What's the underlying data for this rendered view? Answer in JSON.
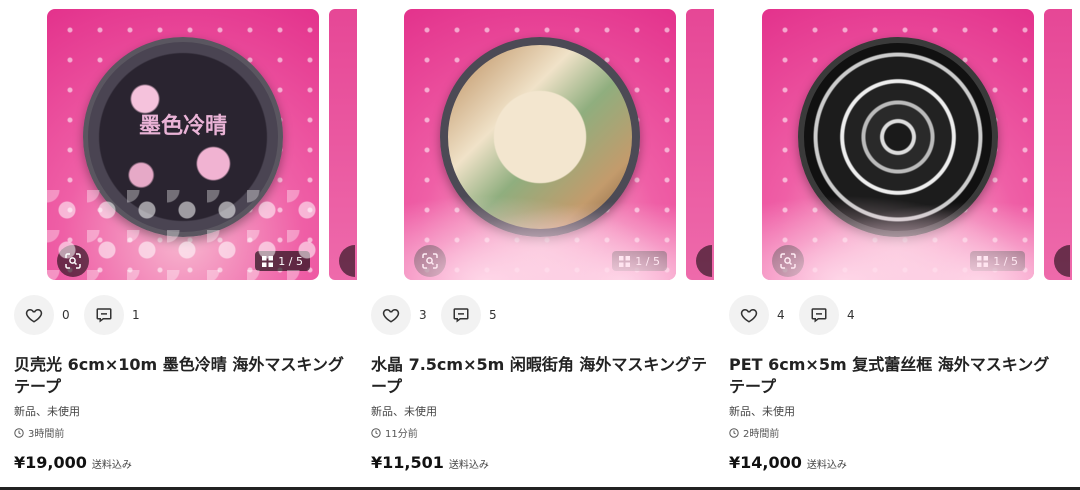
{
  "items": [
    {
      "likes": "0",
      "comments": "1",
      "title": "贝壳光 6cm×10m 墨色冷晴 海外マスキングテープ",
      "condition": "新品、未使用",
      "time": "3時間前",
      "price": "¥19,000",
      "shipping": "送料込み",
      "image_counter": "1 / 5",
      "tape_label": "墨色冷晴"
    },
    {
      "likes": "3",
      "comments": "5",
      "title": "水晶 7.5cm×5m 闲暇街角 海外マスキングテープ",
      "condition": "新品、未使用",
      "time": "11分前",
      "price": "¥11,501",
      "shipping": "送料込み",
      "image_counter": "1 / 5"
    },
    {
      "likes": "4",
      "comments": "4",
      "title": "PET 6cm×5m 复式蕾丝框 海外マスキングテープ",
      "condition": "新品、未使用",
      "time": "2時間前",
      "price": "¥14,000",
      "shipping": "送料込み",
      "image_counter": "1 / 5"
    }
  ],
  "icons": {
    "like": "heart-icon",
    "comment": "comment-icon",
    "time": "clock-icon",
    "lens": "image-search-icon",
    "gallery": "gallery-grid-icon"
  }
}
